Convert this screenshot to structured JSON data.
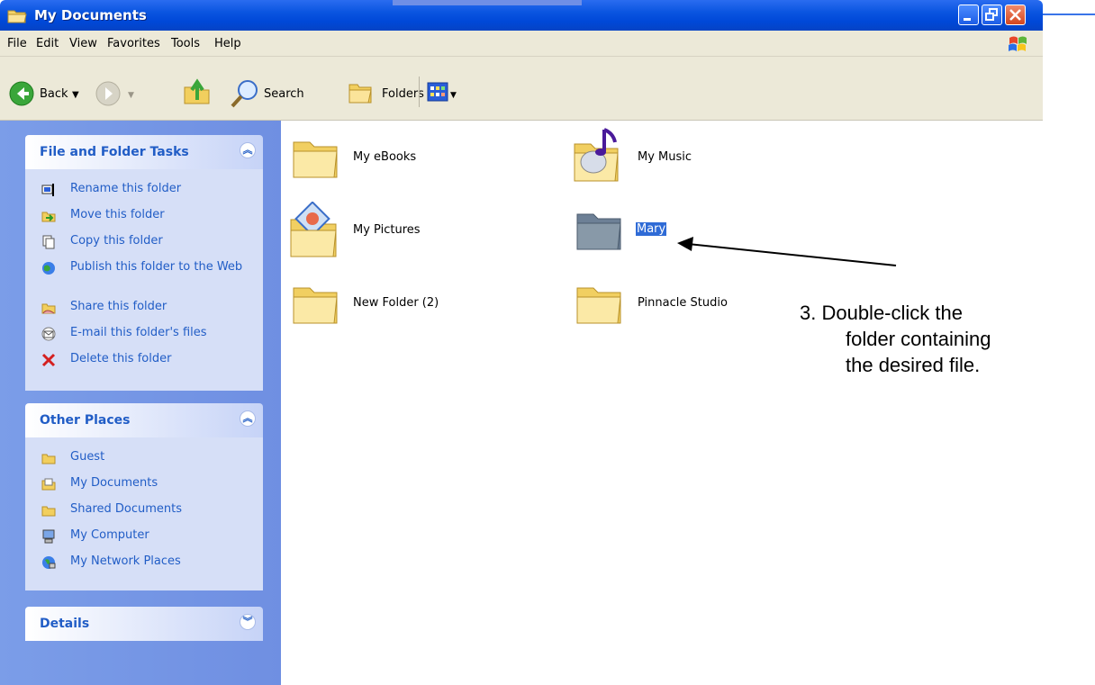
{
  "window": {
    "title": "My Documents"
  },
  "menu": [
    "File",
    "Edit",
    "View",
    "Favorites",
    "Tools",
    "Help"
  ],
  "toolbar": {
    "back": "Back",
    "search": "Search",
    "folders": "Folders"
  },
  "panels": {
    "tasks": {
      "title": "File and Folder Tasks",
      "items": [
        {
          "label": "Rename this folder"
        },
        {
          "label": "Move this folder"
        },
        {
          "label": "Copy this folder"
        },
        {
          "label": "Publish this folder to the Web"
        },
        {
          "label": "Share this folder"
        },
        {
          "label": "E-mail this folder's files"
        },
        {
          "label": "Delete this folder"
        }
      ]
    },
    "places": {
      "title": "Other Places",
      "items": [
        {
          "label": "Guest"
        },
        {
          "label": "My Documents"
        },
        {
          "label": "Shared Documents"
        },
        {
          "label": "My Computer"
        },
        {
          "label": "My Network Places"
        }
      ]
    },
    "details": {
      "title": "Details"
    }
  },
  "folders": [
    {
      "label": "My eBooks"
    },
    {
      "label": "My Music"
    },
    {
      "label": "My Pictures"
    },
    {
      "label": "Mary",
      "selected": true
    },
    {
      "label": "New Folder (2)"
    },
    {
      "label": "Pinnacle Studio"
    }
  ],
  "annotation": {
    "line1": "3.  Double-click the",
    "line2": "folder containing",
    "line3": "the desired file."
  },
  "colors": {
    "titlebar": "#0a55e0",
    "task_text": "#215dc6",
    "selection": "#2f6bd6"
  }
}
